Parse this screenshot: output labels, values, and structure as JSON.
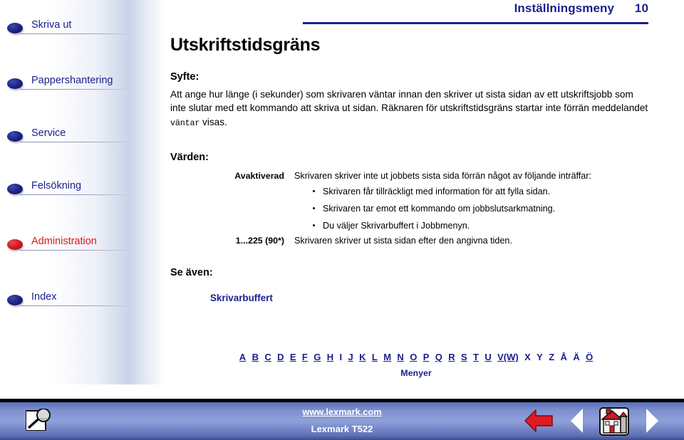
{
  "header": {
    "section_title": "Inställningsmeny",
    "page_number": "10"
  },
  "sidebar": {
    "items": [
      {
        "label": "Skriva ut",
        "color": "#1a1f8c",
        "active": false
      },
      {
        "label": "Pappershantering",
        "color": "#1a1f8c",
        "active": false
      },
      {
        "label": "Service",
        "color": "#1a1f8c",
        "active": false
      },
      {
        "label": "Felsökning",
        "color": "#1a1f8c",
        "active": false
      },
      {
        "label": "Administration",
        "color": "#d61920",
        "active": true
      },
      {
        "label": "Index",
        "color": "#1a1f8c",
        "active": false
      }
    ]
  },
  "main": {
    "title": "Utskriftstidsgräns",
    "purpose_heading": "Syfte:",
    "purpose_text_part1": "Att ange hur länge (i sekunder) som skrivaren väntar innan den skriver ut sista sidan av ett utskriftsjobb som inte slutar med ett kommando att skriva ut sidan. Räknaren för utskriftstidsgräns startar inte förrän meddelandet ",
    "purpose_text_mono": "väntar",
    "purpose_text_part2": " visas.",
    "values_heading": "Värden:",
    "values": [
      {
        "key": "Avaktiverad",
        "description": "Skrivaren skriver inte ut jobbets sista sida förrän något av följande inträffar:",
        "bullets": [
          "Skrivaren får tillräckligt med information för att fylla sidan.",
          "Skrivaren tar emot ett kommando om jobbslutsarkmatning.",
          "Du väljer Skrivarbuffert i Jobbmenyn."
        ]
      },
      {
        "key": "1...225 (90*)",
        "description": "Skrivaren skriver ut sista sidan efter den angivna tiden.",
        "bullets": []
      }
    ],
    "see_also_heading": "Se även:",
    "see_also_link": "Skrivarbuffert"
  },
  "alpha_nav": {
    "letters": [
      "A",
      "B",
      "C",
      "D",
      "E",
      "F",
      "G",
      "H",
      "I",
      "J",
      "K",
      "L",
      "M",
      "N",
      "O",
      "P",
      "Q",
      "R",
      "S",
      "T",
      "U",
      "V(W)",
      "X",
      "Y",
      "Z",
      "Å",
      "Ä",
      "Ö"
    ],
    "menu_link": "Menyer"
  },
  "footer": {
    "url": "www.lexmark.com",
    "model": "Lexmark T522",
    "icons": {
      "search": "search-page-icon",
      "back": "back-arrow-icon",
      "previous": "prev-arrow-icon",
      "home": "home-icon",
      "next": "next-arrow-icon"
    }
  },
  "colors": {
    "navy": "#1a1f8c",
    "red": "#d61920",
    "footer_blue": "#7e90cf"
  }
}
